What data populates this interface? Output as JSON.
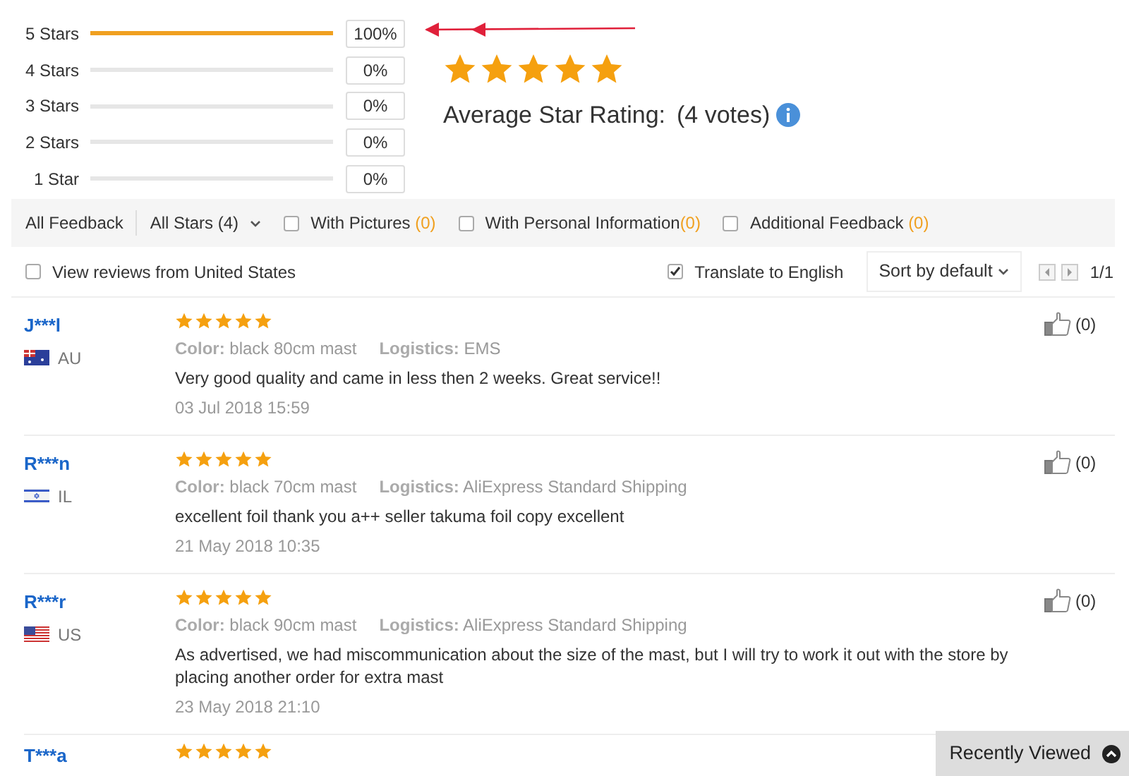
{
  "rating_summary": {
    "bars": [
      {
        "label": "5 Stars",
        "level": 1,
        "percent": "100%"
      },
      {
        "label": "4 Stars",
        "level": 0,
        "percent": "0%"
      },
      {
        "label": "3 Stars",
        "level": 0,
        "percent": "0%"
      },
      {
        "label": "2 Stars",
        "level": 0,
        "percent": "0%"
      },
      {
        "label": "1 Star",
        "level": 0,
        "percent": "0%"
      }
    ],
    "stars": 5,
    "average_label": "Average Star Rating:",
    "votes": "(4 votes)"
  },
  "filters": [
    {
      "kind": "text",
      "label": "All Feedback"
    },
    {
      "kind": "dropdown",
      "label": "All Stars (4)"
    },
    {
      "kind": "checkbox",
      "label": "With Pictures ",
      "count": "(0)",
      "checked": false
    },
    {
      "kind": "checkbox",
      "label": "With Personal Information",
      "count": "(0)",
      "checked": false
    },
    {
      "kind": "checkbox",
      "label": "Additional Feedback ",
      "count": "(0)",
      "checked": false
    }
  ],
  "options": {
    "view_local": {
      "label": "View reviews from United States",
      "checked": false
    },
    "translate": {
      "label": "Translate to English",
      "checked": true
    },
    "sort": "Sort by default",
    "page": "1/1"
  },
  "reviews": [
    {
      "name": "J***l",
      "country": "AU",
      "stars": 5,
      "color_label": "Color:",
      "color_value": "black 80cm mast",
      "logistics_label": "Logistics:",
      "logistics": "EMS",
      "text": "Very good quality and came in less then 2 weeks. Great service!!",
      "date": "03 Jul 2018 15:59",
      "likes": "(0)"
    },
    {
      "name": "R***n",
      "country": "IL",
      "stars": 5,
      "color_label": "Color:",
      "color_value": "black 70cm mast",
      "logistics_label": "Logistics:",
      "logistics": "AliExpress Standard Shipping",
      "text": "excellent foil thank you a++ seller takuma foil copy excellent",
      "date": "21 May 2018 10:35",
      "likes": "(0)"
    },
    {
      "name": "R***r",
      "country": "US",
      "stars": 5,
      "color_label": "Color:",
      "color_value": "black 90cm mast",
      "logistics_label": "Logistics:",
      "logistics": "AliExpress Standard Shipping",
      "text": "As advertised, we had miscommunication about the size of the mast, but I will try to work it out with the store by placing another order for extra mast",
      "date": "23 May 2018 21:10",
      "likes": "(0)"
    },
    {
      "name": "T***a",
      "stars": 5
    }
  ],
  "recently_viewed": "Recently Viewed"
}
